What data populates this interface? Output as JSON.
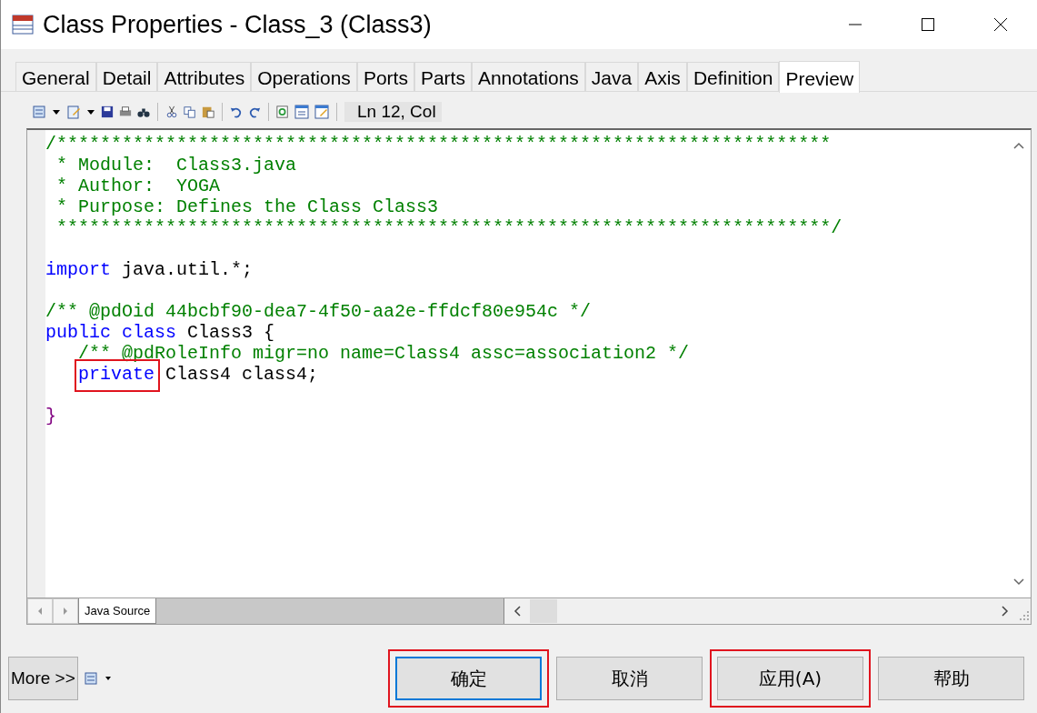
{
  "window": {
    "title": "Class Properties - Class_3 (Class3)"
  },
  "tabs": [
    {
      "label": "General",
      "selected": false
    },
    {
      "label": "Detail",
      "selected": false
    },
    {
      "label": "Attributes",
      "selected": false
    },
    {
      "label": "Operations",
      "selected": false
    },
    {
      "label": "Ports",
      "selected": false
    },
    {
      "label": "Parts",
      "selected": false
    },
    {
      "label": "Annotations",
      "selected": false
    },
    {
      "label": "Java",
      "selected": false
    },
    {
      "label": "Axis",
      "selected": false
    },
    {
      "label": "Definition",
      "selected": false
    },
    {
      "label": "Preview",
      "selected": true
    }
  ],
  "toolbar": {
    "position": "Ln 12, Col"
  },
  "code_lines": [
    {
      "kind": "code",
      "indented": false,
      "tokens": [
        {
          "kind": "comment",
          "text": "/***********************************************************************"
        }
      ]
    },
    {
      "kind": "code",
      "indented": false,
      "tokens": [
        {
          "kind": "comment",
          "text": " * Module:  Class3.java"
        }
      ]
    },
    {
      "kind": "code",
      "indented": false,
      "tokens": [
        {
          "kind": "comment",
          "text": " * Author:  YOGA"
        }
      ]
    },
    {
      "kind": "code",
      "indented": false,
      "tokens": [
        {
          "kind": "comment",
          "text": " * Purpose: Defines the Class Class3"
        }
      ]
    },
    {
      "kind": "code",
      "indented": false,
      "tokens": [
        {
          "kind": "comment",
          "text": " ***********************************************************************/"
        }
      ]
    },
    {
      "kind": "blank"
    },
    {
      "kind": "code",
      "indented": false,
      "tokens": [
        {
          "kind": "keyword",
          "text": "import"
        },
        {
          "kind": "plain",
          "text": " java.util.*;"
        }
      ]
    },
    {
      "kind": "blank"
    },
    {
      "kind": "code",
      "indented": false,
      "tokens": [
        {
          "kind": "comment",
          "text": "/** @pdOid 44bcbf90-dea7-4f50-aa2e-ffdcf80e954c */"
        }
      ]
    },
    {
      "kind": "code",
      "indented": false,
      "tokens": [
        {
          "kind": "keyword",
          "text": "public class"
        },
        {
          "kind": "plain",
          "text": " Class3 {"
        }
      ]
    },
    {
      "kind": "code",
      "indented": true,
      "tokens": [
        {
          "kind": "comment",
          "text": "/** @pdRoleInfo migr=no name=Class4 assc=association2 */"
        }
      ]
    },
    {
      "kind": "code",
      "indented": true,
      "tokens": [
        {
          "kind": "keyword",
          "text": "private",
          "highlighted": true
        },
        {
          "kind": "plain",
          "text": " Class4 class4;"
        }
      ]
    },
    {
      "kind": "blank"
    },
    {
      "kind": "code",
      "indented": false,
      "tokens": [
        {
          "kind": "brace",
          "text": "}"
        }
      ]
    }
  ],
  "source_tabs": [
    {
      "label": "Java Source",
      "selected": true
    }
  ],
  "more_button": "More >>",
  "buttons": [
    {
      "label": "确定",
      "highlighted": true,
      "focused": true
    },
    {
      "label": "取消",
      "highlighted": false,
      "focused": false
    },
    {
      "label": "应用(A)",
      "highlighted": true,
      "focused": false
    },
    {
      "label": "帮助",
      "highlighted": false,
      "focused": false
    }
  ]
}
